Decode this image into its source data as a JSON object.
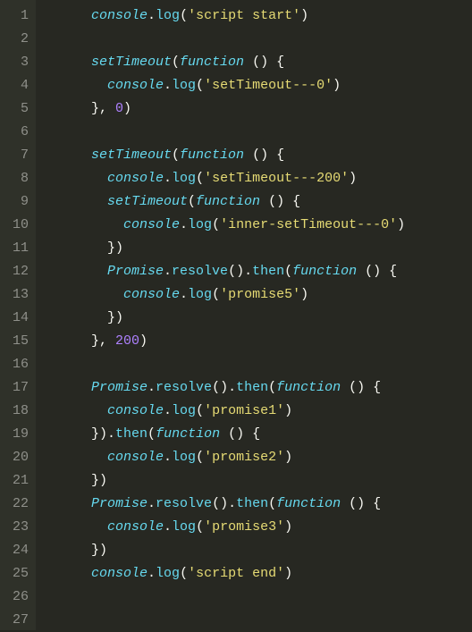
{
  "editor": {
    "language": "javascript",
    "theme": "monokai",
    "line_count": 27,
    "indent_size": 2,
    "base_indent": 3,
    "lines": [
      {
        "n": 1,
        "indent": 3,
        "tokens": [
          [
            "obj",
            "console"
          ],
          [
            "punct",
            "."
          ],
          [
            "method",
            "log"
          ],
          [
            "punct",
            "("
          ],
          [
            "string",
            "'script start'"
          ],
          [
            "punct",
            ")"
          ]
        ]
      },
      {
        "n": 2,
        "indent": 0,
        "tokens": []
      },
      {
        "n": 3,
        "indent": 3,
        "tokens": [
          [
            "obj",
            "setTimeout"
          ],
          [
            "punct",
            "("
          ],
          [
            "kw",
            "function"
          ],
          [
            "punct",
            " () {"
          ]
        ]
      },
      {
        "n": 4,
        "indent": 4,
        "tokens": [
          [
            "obj",
            "console"
          ],
          [
            "punct",
            "."
          ],
          [
            "method",
            "log"
          ],
          [
            "punct",
            "("
          ],
          [
            "string",
            "'setTimeout---0'"
          ],
          [
            "punct",
            ")"
          ]
        ]
      },
      {
        "n": 5,
        "indent": 3,
        "tokens": [
          [
            "punct",
            "}, "
          ],
          [
            "num",
            "0"
          ],
          [
            "punct",
            ")"
          ]
        ]
      },
      {
        "n": 6,
        "indent": 0,
        "tokens": []
      },
      {
        "n": 7,
        "indent": 3,
        "tokens": [
          [
            "obj",
            "setTimeout"
          ],
          [
            "punct",
            "("
          ],
          [
            "kw",
            "function"
          ],
          [
            "punct",
            " () {"
          ]
        ]
      },
      {
        "n": 8,
        "indent": 4,
        "tokens": [
          [
            "obj",
            "console"
          ],
          [
            "punct",
            "."
          ],
          [
            "method",
            "log"
          ],
          [
            "punct",
            "("
          ],
          [
            "string",
            "'setTimeout---200'"
          ],
          [
            "punct",
            ")"
          ]
        ]
      },
      {
        "n": 9,
        "indent": 4,
        "tokens": [
          [
            "obj",
            "setTimeout"
          ],
          [
            "punct",
            "("
          ],
          [
            "kw",
            "function"
          ],
          [
            "punct",
            " () {"
          ]
        ]
      },
      {
        "n": 10,
        "indent": 5,
        "tokens": [
          [
            "obj",
            "console"
          ],
          [
            "punct",
            "."
          ],
          [
            "method",
            "log"
          ],
          [
            "punct",
            "("
          ],
          [
            "string",
            "'inner-setTimeout---0'"
          ],
          [
            "punct",
            ")"
          ]
        ]
      },
      {
        "n": 11,
        "indent": 4,
        "tokens": [
          [
            "punct",
            "})"
          ]
        ]
      },
      {
        "n": 12,
        "indent": 4,
        "tokens": [
          [
            "obj",
            "Promise"
          ],
          [
            "punct",
            "."
          ],
          [
            "method",
            "resolve"
          ],
          [
            "punct",
            "()."
          ],
          [
            "method",
            "then"
          ],
          [
            "punct",
            "("
          ],
          [
            "kw",
            "function"
          ],
          [
            "punct",
            " () {"
          ]
        ]
      },
      {
        "n": 13,
        "indent": 5,
        "tokens": [
          [
            "obj",
            "console"
          ],
          [
            "punct",
            "."
          ],
          [
            "method",
            "log"
          ],
          [
            "punct",
            "("
          ],
          [
            "string",
            "'promise5'"
          ],
          [
            "punct",
            ")"
          ]
        ]
      },
      {
        "n": 14,
        "indent": 4,
        "tokens": [
          [
            "punct",
            "})"
          ]
        ]
      },
      {
        "n": 15,
        "indent": 3,
        "tokens": [
          [
            "punct",
            "}, "
          ],
          [
            "num",
            "200"
          ],
          [
            "punct",
            ")"
          ]
        ]
      },
      {
        "n": 16,
        "indent": 0,
        "tokens": []
      },
      {
        "n": 17,
        "indent": 3,
        "tokens": [
          [
            "obj",
            "Promise"
          ],
          [
            "punct",
            "."
          ],
          [
            "method",
            "resolve"
          ],
          [
            "punct",
            "()."
          ],
          [
            "method",
            "then"
          ],
          [
            "punct",
            "("
          ],
          [
            "kw",
            "function"
          ],
          [
            "punct",
            " () {"
          ]
        ]
      },
      {
        "n": 18,
        "indent": 4,
        "tokens": [
          [
            "obj",
            "console"
          ],
          [
            "punct",
            "."
          ],
          [
            "method",
            "log"
          ],
          [
            "punct",
            "("
          ],
          [
            "string",
            "'promise1'"
          ],
          [
            "punct",
            ")"
          ]
        ]
      },
      {
        "n": 19,
        "indent": 3,
        "tokens": [
          [
            "punct",
            "})."
          ],
          [
            "method",
            "then"
          ],
          [
            "punct",
            "("
          ],
          [
            "kw",
            "function"
          ],
          [
            "punct",
            " () {"
          ]
        ]
      },
      {
        "n": 20,
        "indent": 4,
        "tokens": [
          [
            "obj",
            "console"
          ],
          [
            "punct",
            "."
          ],
          [
            "method",
            "log"
          ],
          [
            "punct",
            "("
          ],
          [
            "string",
            "'promise2'"
          ],
          [
            "punct",
            ")"
          ]
        ]
      },
      {
        "n": 21,
        "indent": 3,
        "tokens": [
          [
            "punct",
            "})"
          ]
        ]
      },
      {
        "n": 22,
        "indent": 3,
        "tokens": [
          [
            "obj",
            "Promise"
          ],
          [
            "punct",
            "."
          ],
          [
            "method",
            "resolve"
          ],
          [
            "punct",
            "()."
          ],
          [
            "method",
            "then"
          ],
          [
            "punct",
            "("
          ],
          [
            "kw",
            "function"
          ],
          [
            "punct",
            " () {"
          ]
        ]
      },
      {
        "n": 23,
        "indent": 4,
        "tokens": [
          [
            "obj",
            "console"
          ],
          [
            "punct",
            "."
          ],
          [
            "method",
            "log"
          ],
          [
            "punct",
            "("
          ],
          [
            "string",
            "'promise3'"
          ],
          [
            "punct",
            ")"
          ]
        ]
      },
      {
        "n": 24,
        "indent": 3,
        "tokens": [
          [
            "punct",
            "})"
          ]
        ]
      },
      {
        "n": 25,
        "indent": 3,
        "tokens": [
          [
            "obj",
            "console"
          ],
          [
            "punct",
            "."
          ],
          [
            "method",
            "log"
          ],
          [
            "punct",
            "("
          ],
          [
            "string",
            "'script end'"
          ],
          [
            "punct",
            ")"
          ]
        ]
      },
      {
        "n": 26,
        "indent": 0,
        "tokens": []
      },
      {
        "n": 27,
        "indent": 0,
        "tokens": []
      }
    ]
  }
}
